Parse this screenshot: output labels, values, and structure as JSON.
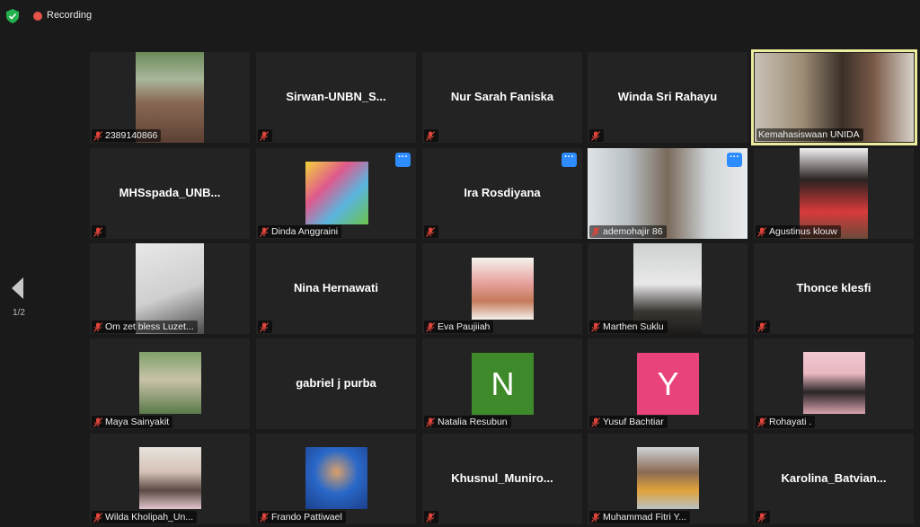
{
  "topbar": {
    "recording_label": "Recording"
  },
  "pager": {
    "indicator": "1/2"
  },
  "colors": {
    "muted_mic": "#e0453b",
    "more_button": "#2d8cff",
    "active_speaker": "#ecec9c"
  },
  "tiles": [
    {
      "name": "2389140866",
      "kind": "video"
    },
    {
      "name": "Sirwan-UNBN_S...",
      "kind": "name"
    },
    {
      "name": "Nur Sarah Faniska",
      "kind": "name"
    },
    {
      "name": "Winda Sri Rahayu",
      "kind": "name"
    },
    {
      "name": "Kemahasiswaan UNIDA",
      "kind": "video",
      "active": true
    },
    {
      "name": "MHSspada_UNB...",
      "kind": "name"
    },
    {
      "name": "Dinda Anggraini",
      "kind": "video",
      "more": true
    },
    {
      "name": "Ira Rosdiyana",
      "kind": "name",
      "more": true
    },
    {
      "name": "ademohajir 86",
      "kind": "video",
      "more": true
    },
    {
      "name": "Agustinus klouw",
      "kind": "video"
    },
    {
      "name": "Om zet bless Luzet...",
      "kind": "video"
    },
    {
      "name": "Nina Hernawati",
      "kind": "name"
    },
    {
      "name": "Eva Paujiiah",
      "kind": "video"
    },
    {
      "name": "Marthen Suklu",
      "kind": "video"
    },
    {
      "name": "Thonce klesfi",
      "kind": "name"
    },
    {
      "name": "Maya Sainyakit",
      "kind": "video"
    },
    {
      "name": "gabriel j purba",
      "kind": "name"
    },
    {
      "name": "Natalia Resubun",
      "kind": "avatar",
      "letter": "N"
    },
    {
      "name": "Yusuf Bachtiar",
      "kind": "avatar",
      "letter": "Y"
    },
    {
      "name": "Rohayati .",
      "kind": "video"
    },
    {
      "name": "Wilda Kholipah_Un...",
      "kind": "video"
    },
    {
      "name": "Frando Pattiwael",
      "kind": "video"
    },
    {
      "name": "Khusnul_Muniro...",
      "kind": "name"
    },
    {
      "name": "Muhammad Fitri Y...",
      "kind": "video"
    },
    {
      "name": "Karolina_Batvian...",
      "kind": "name"
    }
  ]
}
